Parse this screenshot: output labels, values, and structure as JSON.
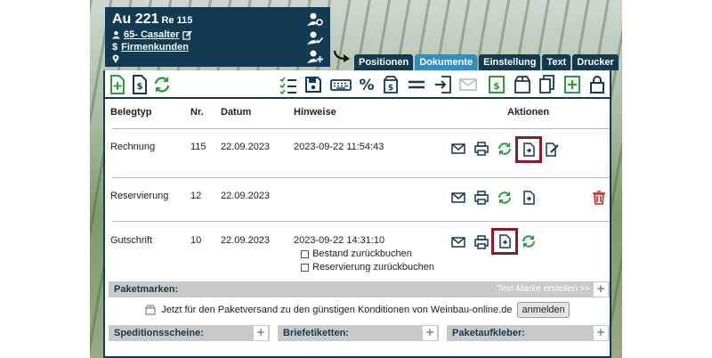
{
  "customer": {
    "title": "Au 221",
    "re": "Re 115",
    "contact": "65- Casalter",
    "group": "Firmenkunden"
  },
  "tabs": [
    {
      "label": "Positionen"
    },
    {
      "label": "Dokumente"
    },
    {
      "label": "Einstellung"
    },
    {
      "label": "Text"
    },
    {
      "label": "Drucker"
    }
  ],
  "table": {
    "headers": {
      "type": "Belegtyp",
      "nr": "Nr.",
      "date": "Datum",
      "notes": "Hinweise",
      "actions": "Aktionen"
    },
    "rows": [
      {
        "type": "Rechnung",
        "nr": "115",
        "date": "22.09.2023",
        "notes": "2023-09-22 11:54:43"
      },
      {
        "type": "Reservierung",
        "nr": "12",
        "date": "22.09.2023",
        "notes": ""
      },
      {
        "type": "Gutschrift",
        "nr": "10",
        "date": "22.09.2023",
        "notes": "2023-09-22 14:31:10"
      }
    ],
    "checkboxes": [
      "Bestand zurückbuchen",
      "Reservierung zurückbuchen"
    ]
  },
  "paketmarken": {
    "label": "Paketmarken:",
    "test_link": "Test-Marke erstellen >>",
    "promo_text": "Jetzt für den Paketversand zu den günstigen Konditionen von Weinbau-online.de",
    "login_button": "anmelden"
  },
  "bottom": {
    "shipping": "Speditionsscheine:",
    "letters": "Briefetiketten:",
    "stickers": "Paketaufkleber:"
  },
  "colors": {
    "navy": "#123a52",
    "green": "#2a9d3a",
    "accent": "#2d8fc3",
    "highlight": "#8e1b2a",
    "danger": "#c62828"
  }
}
